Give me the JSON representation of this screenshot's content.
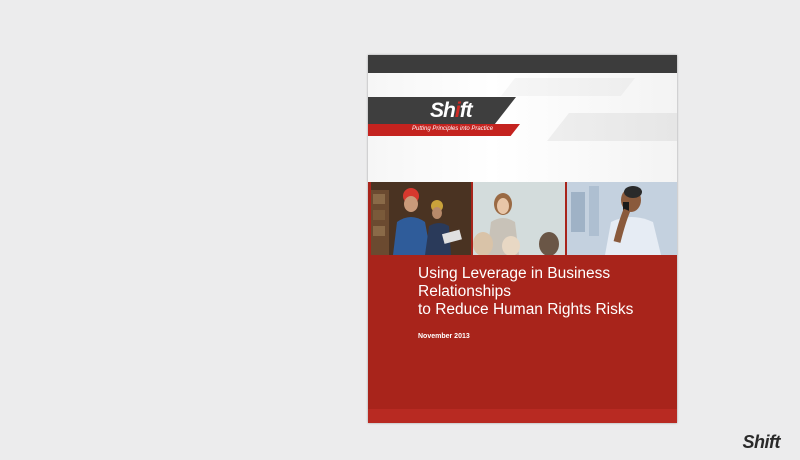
{
  "cover": {
    "logo": "Shift",
    "tagline": "Putting Principles into Practice",
    "title_line1": "Using Leverage in Business Relationships",
    "title_line2": "to Reduce Human Rights Risks",
    "date": "November 2013",
    "photos": [
      "worker-photo",
      "meeting-photo",
      "phone-call-photo"
    ]
  },
  "brand": {
    "name": "Shift"
  },
  "colors": {
    "red": "#a8241b",
    "dark": "#3c3c3c",
    "background": "#ececed"
  }
}
